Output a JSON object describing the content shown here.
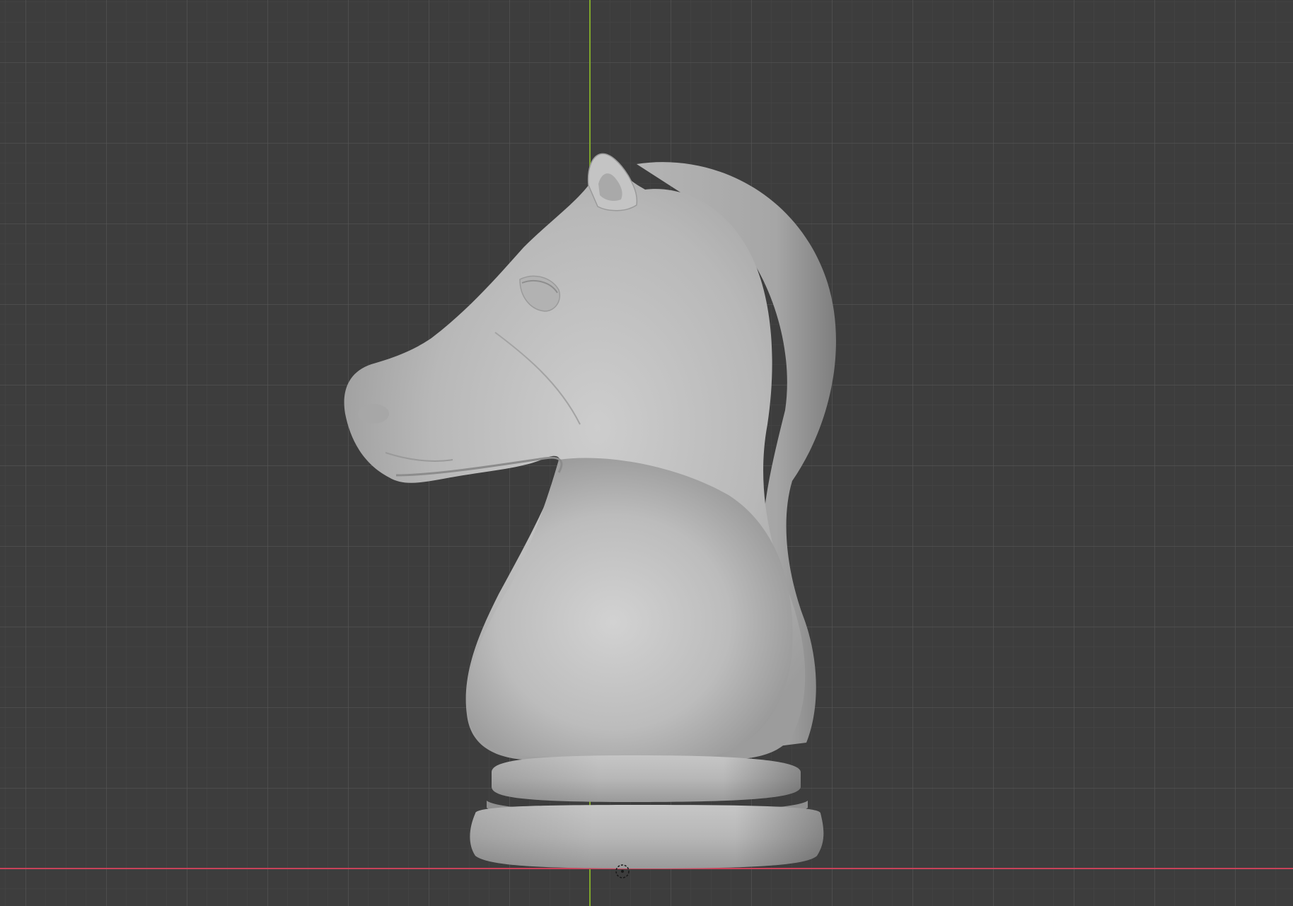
{
  "viewport": {
    "view": "front-orthographic",
    "background_color": "#3d3d3d",
    "grid": {
      "visible": true,
      "minor_color": "#464646",
      "major_color": "#545454"
    },
    "axes": {
      "x_axis_color": "#c8425a",
      "z_axis_color": "#7fa62c"
    }
  },
  "object": {
    "type": "chess-knight",
    "material_color": "#bfbfbf",
    "shading": "solid"
  },
  "icons": {
    "origin": "object-origin-icon"
  }
}
